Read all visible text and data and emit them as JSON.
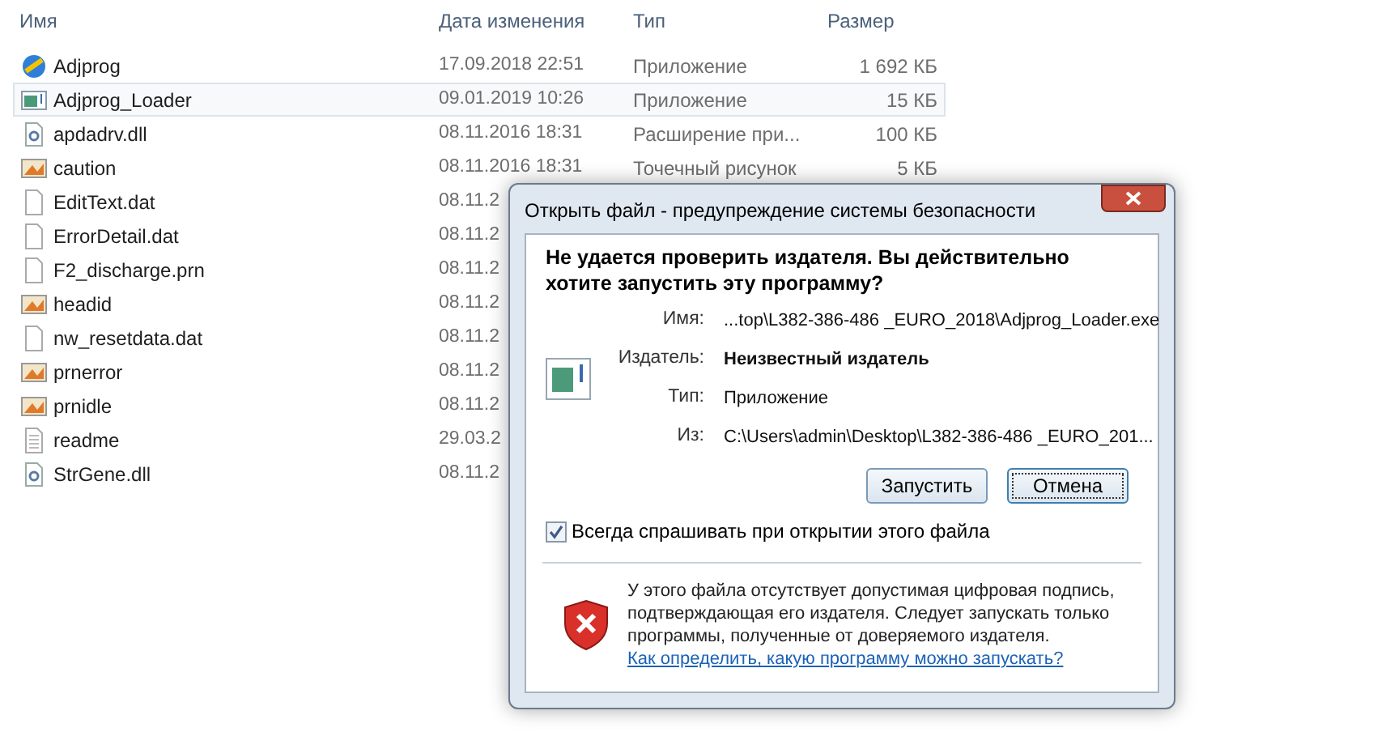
{
  "explorer": {
    "columns": [
      "Имя",
      "Дата изменения",
      "Тип",
      "Размер"
    ],
    "rows": [
      {
        "name": "Adjprog",
        "kind": "app",
        "date": "17.09.2018 22:51",
        "type": "Приложение",
        "size": "1 692 КБ",
        "selected": false
      },
      {
        "name": "Adjprog_Loader",
        "kind": "window",
        "date": "09.01.2019 10:26",
        "type": "Приложение",
        "size": "15 КБ",
        "selected": true
      },
      {
        "name": "apdadrv.dll",
        "kind": "dll",
        "date": "08.11.2016 18:31",
        "type": "Расширение при...",
        "size": "100 КБ",
        "selected": false
      },
      {
        "name": "caution",
        "kind": "image",
        "date": "08.11.2016 18:31",
        "type": "Точечный рисунок",
        "size": "5 КБ",
        "selected": false
      },
      {
        "name": "EditText.dat",
        "kind": "file",
        "date": "08.11.2",
        "selected": false
      },
      {
        "name": "ErrorDetail.dat",
        "kind": "file",
        "date": "08.11.2",
        "selected": false
      },
      {
        "name": "F2_discharge.prn",
        "kind": "file",
        "date": "08.11.2",
        "selected": false
      },
      {
        "name": "headid",
        "kind": "image",
        "date": "08.11.2",
        "selected": false
      },
      {
        "name": "nw_resetdata.dat",
        "kind": "file",
        "date": "08.11.2",
        "selected": false
      },
      {
        "name": "prnerror",
        "kind": "image",
        "date": "08.11.2",
        "selected": false
      },
      {
        "name": "prnidle",
        "kind": "image",
        "date": "08.11.2",
        "selected": false
      },
      {
        "name": "readme",
        "kind": "text",
        "date": "29.03.2",
        "selected": false
      },
      {
        "name": "StrGene.dll",
        "kind": "dll",
        "date": "08.11.2",
        "selected": false
      }
    ]
  },
  "dialog": {
    "title": "Открыть файл - предупреждение системы безопасности",
    "heading": "Не удается проверить издателя.  Вы действительно хотите запустить эту программу?",
    "fields": [
      {
        "label": "Имя:",
        "value": "...top\\L382-386-486 _EURO_2018\\Adjprog_Loader.exe",
        "bold": false
      },
      {
        "label": "Издатель:",
        "value": "Неизвестный издатель",
        "bold": true
      },
      {
        "label": "Тип:",
        "value": "Приложение",
        "bold": false
      },
      {
        "label": "Из:",
        "value": "C:\\Users\\admin\\Desktop\\L382-386-486 _EURO_201...",
        "bold": false
      }
    ],
    "buttons": [
      {
        "label": "Запустить",
        "focused": false
      },
      {
        "label": "Отмена",
        "focused": true
      }
    ],
    "checkbox": {
      "label": "Всегда спрашивать при открытии этого файла",
      "checked": true
    },
    "warning": {
      "text": "У этого файла отсутствует допустимая цифровая подпись, подтверждающая его издателя.  Следует запускать только программы, полученные от доверяемого издателя.",
      "link": "Как определить, какую программу можно запускать?"
    }
  }
}
